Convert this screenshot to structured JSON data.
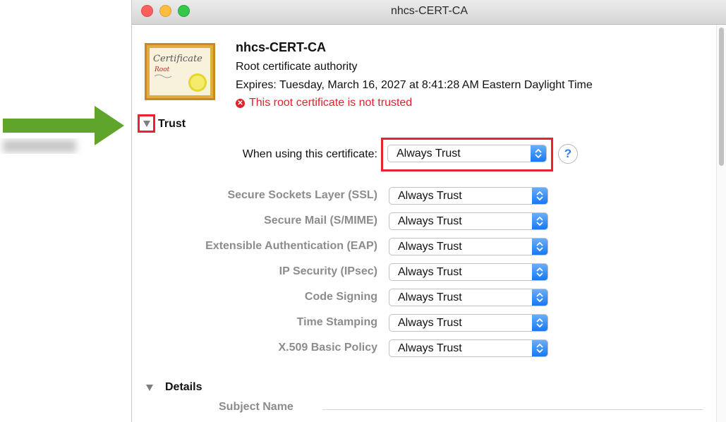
{
  "window": {
    "title": "nhcs-CERT-CA"
  },
  "certificate": {
    "icon": "certificate-icon",
    "icon_script": "Certificate",
    "icon_subscript": "Root",
    "name": "nhcs-CERT-CA",
    "type": "Root certificate authority",
    "expires": "Expires: Tuesday, March 16, 2027 at 8:41:28 AM Eastern Daylight Time",
    "warning": "This root certificate is not trusted",
    "warning_color": "#e0232b"
  },
  "trust": {
    "label": "Trust",
    "when_using_label": "When using this certificate:",
    "when_using_value": "Always Trust",
    "help_label": "?",
    "rows": [
      {
        "label": "Secure Sockets Layer (SSL)",
        "value": "Always Trust"
      },
      {
        "label": "Secure Mail (S/MIME)",
        "value": "Always Trust"
      },
      {
        "label": "Extensible Authentication (EAP)",
        "value": "Always Trust"
      },
      {
        "label": "IP Security (IPsec)",
        "value": "Always Trust"
      },
      {
        "label": "Code Signing",
        "value": "Always Trust"
      },
      {
        "label": "Time Stamping",
        "value": "Always Trust"
      },
      {
        "label": "X.509 Basic Policy",
        "value": "Always Trust"
      }
    ]
  },
  "details": {
    "label": "Details",
    "subject_name": "Subject Name"
  },
  "annotations": {
    "highlight_color": "#e8232f",
    "arrow_color": "#5fa52c"
  }
}
